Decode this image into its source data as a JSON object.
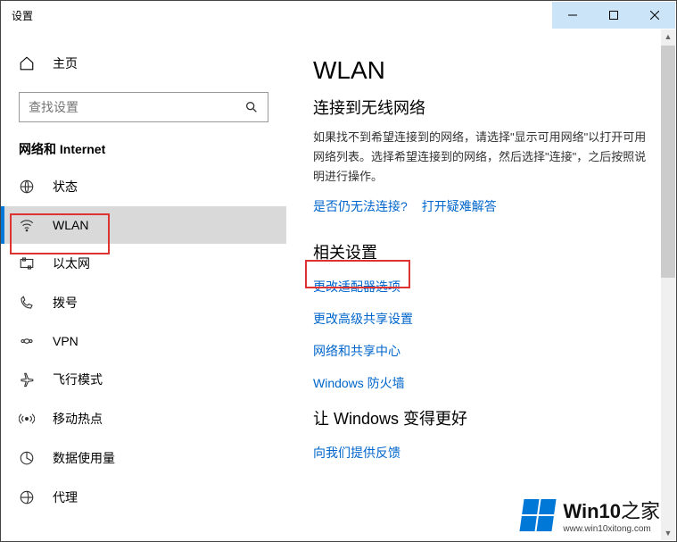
{
  "window": {
    "title": "设置"
  },
  "sidebar": {
    "home_label": "主页",
    "search_placeholder": "查找设置",
    "category": "网络和 Internet",
    "items": [
      {
        "label": "状态"
      },
      {
        "label": "WLAN"
      },
      {
        "label": "以太网"
      },
      {
        "label": "拨号"
      },
      {
        "label": "VPN"
      },
      {
        "label": "飞行模式"
      },
      {
        "label": "移动热点"
      },
      {
        "label": "数据使用量"
      },
      {
        "label": "代理"
      }
    ]
  },
  "main": {
    "title": "WLAN",
    "subtitle": "连接到无线网络",
    "description": "如果找不到希望连接到的网络，请选择\"显示可用网络\"以打开可用网络列表。选择希望连接到的网络，然后选择\"连接\"，之后按照说明进行操作。",
    "help_links": {
      "still_cannot_connect": "是否仍无法连接?",
      "troubleshoot": "打开疑难解答"
    },
    "related_title": "相关设置",
    "related_links": {
      "adapter_options": "更改适配器选项",
      "advanced_sharing": "更改高级共享设置",
      "sharing_center": "网络和共享中心",
      "windows_firewall": "Windows 防火墙"
    },
    "feedback_title": "让 Windows 变得更好",
    "feedback_link": "向我们提供反馈"
  },
  "watermark": {
    "brand": "Win10",
    "suffix": "之家",
    "url": "www.win10xitong.com"
  }
}
